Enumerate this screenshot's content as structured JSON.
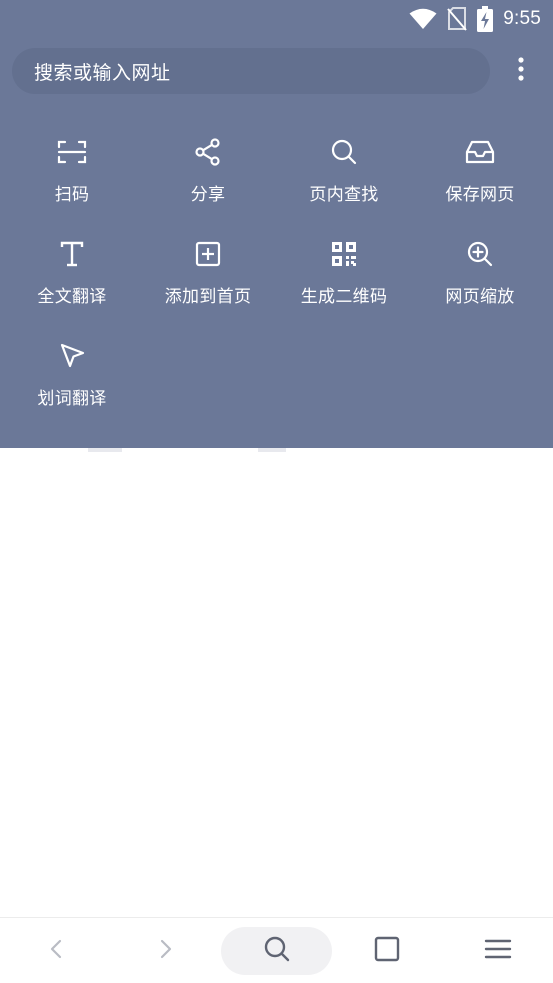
{
  "status_bar": {
    "time": "9:55",
    "icons": [
      "wifi-icon",
      "no-sim-icon",
      "battery-charging-icon"
    ]
  },
  "search": {
    "placeholder": "搜索或输入网址",
    "more_icon": "more-vertical-icon"
  },
  "tools": [
    {
      "label": "扫码",
      "icon": "scan-icon"
    },
    {
      "label": "分享",
      "icon": "share-icon"
    },
    {
      "label": "页内查找",
      "icon": "search-icon"
    },
    {
      "label": "保存网页",
      "icon": "inbox-save-icon"
    },
    {
      "label": "全文翻译",
      "icon": "text-icon"
    },
    {
      "label": "添加到首页",
      "icon": "add-square-icon"
    },
    {
      "label": "生成二维码",
      "icon": "qr-code-icon"
    },
    {
      "label": "网页缩放",
      "icon": "zoom-in-icon"
    },
    {
      "label": "划词翻译",
      "icon": "pointer-icon"
    }
  ],
  "bottom_nav": [
    {
      "name": "back",
      "icon": "chevron-left-icon"
    },
    {
      "name": "forward",
      "icon": "chevron-right-icon"
    },
    {
      "name": "search",
      "icon": "search-icon"
    },
    {
      "name": "tabs",
      "icon": "square-icon"
    },
    {
      "name": "menu",
      "icon": "hamburger-menu-icon"
    }
  ],
  "colors": {
    "panel": "#6b7898",
    "search_box": "#63708f",
    "icon_white": "#ffffff",
    "nav_icon": "#5f6472",
    "nav_disabled": "#b9bcc4"
  }
}
